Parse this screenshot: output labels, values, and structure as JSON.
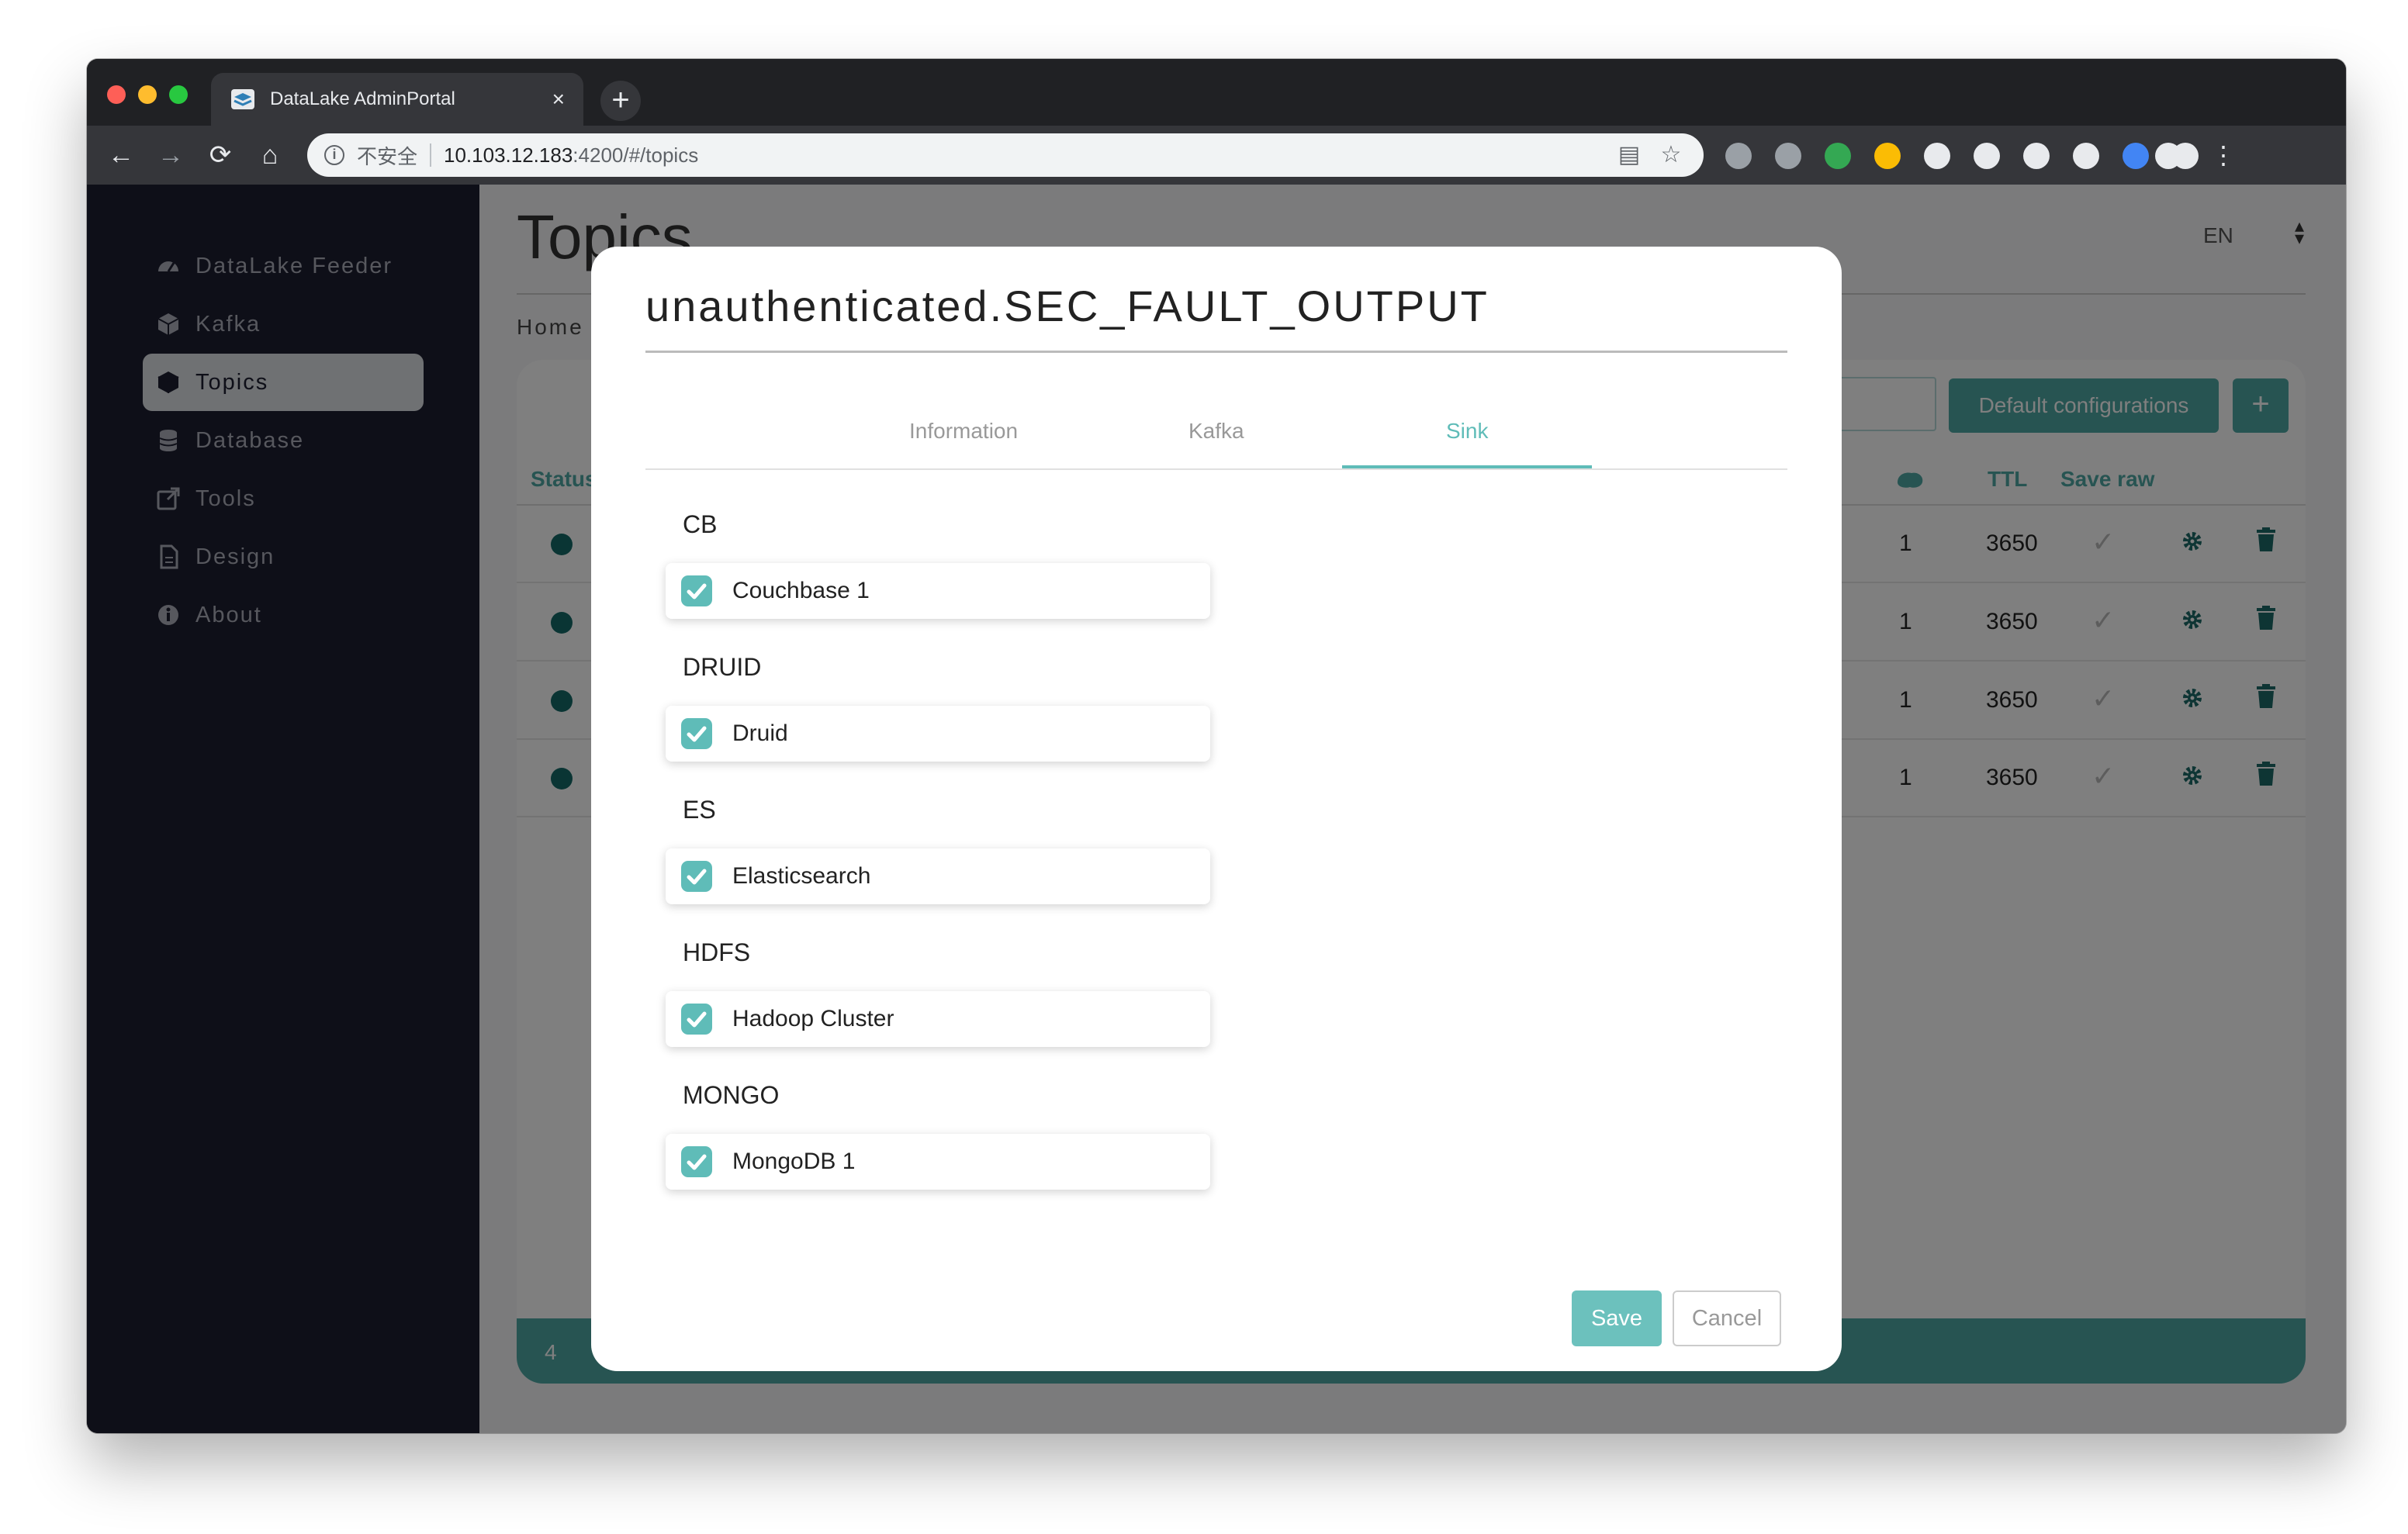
{
  "browser": {
    "tab_title": "DataLake AdminPortal",
    "tab_close": "×",
    "new_tab": "+",
    "security_label": "不安全",
    "url_host": "10.103.12.183",
    "url_path": ":4200/#/topics",
    "extension_colors": [
      "#9aa0a6",
      "#9aa0a6",
      "#34a853",
      "#fbbc04",
      "#e8eaed",
      "#e8eaed",
      "#e8eaed",
      "#e8eaed",
      "#4285f4",
      "#e8eaed"
    ]
  },
  "sidebar": {
    "items": [
      {
        "label": "DataLake Feeder",
        "icon": "dashboard-icon"
      },
      {
        "label": "Kafka",
        "icon": "cube-icon"
      },
      {
        "label": "Topics",
        "icon": "cube-icon",
        "active": true
      },
      {
        "label": "Database",
        "icon": "database-icon"
      },
      {
        "label": "Tools",
        "icon": "external-link-icon"
      },
      {
        "label": "Design",
        "icon": "file-icon"
      },
      {
        "label": "About",
        "icon": "info-icon"
      }
    ]
  },
  "page": {
    "heading": "Topics",
    "language": "EN",
    "breadcrumb": "Home",
    "default_config_label": "Default configurations",
    "add_label": "+",
    "columns": {
      "status": "Status",
      "ttl": "TTL",
      "save_raw": "Save raw"
    },
    "rows": [
      {
        "partitions": "1",
        "ttl": "3650"
      },
      {
        "partitions": "1",
        "ttl": "3650"
      },
      {
        "partitions": "1",
        "ttl": "3650"
      },
      {
        "partitions": "1",
        "ttl": "3650"
      }
    ],
    "footer_count": "4"
  },
  "modal": {
    "title": "unauthenticated.SEC_FAULT_OUTPUT",
    "tabs": [
      "Information",
      "Kafka",
      "Sink"
    ],
    "active_tab": "Sink",
    "groups": [
      {
        "title": "CB",
        "items": [
          {
            "label": "Couchbase 1",
            "checked": true
          }
        ]
      },
      {
        "title": "DRUID",
        "items": [
          {
            "label": "Druid",
            "checked": true
          }
        ]
      },
      {
        "title": "ES",
        "items": [
          {
            "label": "Elasticsearch",
            "checked": true
          }
        ]
      },
      {
        "title": "HDFS",
        "items": [
          {
            "label": "Hadoop Cluster",
            "checked": true
          }
        ]
      },
      {
        "title": "MONGO",
        "items": [
          {
            "label": "MongoDB 1",
            "checked": true
          }
        ]
      }
    ],
    "save_label": "Save",
    "cancel_label": "Cancel"
  },
  "colors": {
    "accent": "#5fbcb8",
    "sidebar_bg": "#1d1e30",
    "status_dot": "#156b68"
  }
}
